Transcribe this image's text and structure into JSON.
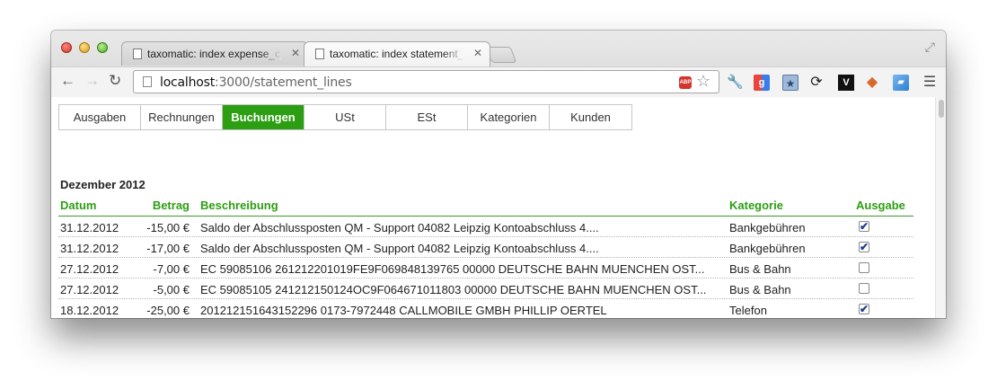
{
  "browser": {
    "tabs": [
      {
        "label": "taxomatic: index expense_ca"
      },
      {
        "label": "taxomatic: index statement_"
      }
    ],
    "url_host": "localhost",
    "url_rest": ":3000/statement_lines",
    "abp_text": "ABP",
    "extension_icons": [
      "wrench-icon",
      "google-icon",
      "bookmark-icon",
      "sync-icon",
      "vim-icon",
      "fox-icon",
      "note-icon",
      "menu-icon"
    ]
  },
  "nav": {
    "items": [
      {
        "label": "Ausgaben"
      },
      {
        "label": "Rechnungen"
      },
      {
        "label": "Buchungen"
      },
      {
        "label": "USt"
      },
      {
        "label": "ESt"
      },
      {
        "label": "Kategorien"
      },
      {
        "label": "Kunden"
      }
    ],
    "active_color": "#2c9e12"
  },
  "statements": {
    "month": "Dezember 2012",
    "headers": {
      "date": "Datum",
      "amount": "Betrag",
      "description": "Beschreibung",
      "category": "Kategorie",
      "expense": "Ausgabe"
    },
    "rows": [
      {
        "date": "31.12.2012",
        "amount": "-15,00 €",
        "description": "Saldo der Abschlussposten QM - Support 04082 Leipzig Kontoabschluss 4....",
        "category": "Bankgebühren",
        "expense": true
      },
      {
        "date": "31.12.2012",
        "amount": "-17,00 €",
        "description": "Saldo der Abschlussposten QM - Support 04082 Leipzig Kontoabschluss 4....",
        "category": "Bankgebühren",
        "expense": true
      },
      {
        "date": "27.12.2012",
        "amount": "-7,00 €",
        "description": "EC 59085106 261212201019FE9F069848139765 00000 DEUTSCHE BAHN MUENCHEN OST...",
        "category": "Bus & Bahn",
        "expense": false
      },
      {
        "date": "27.12.2012",
        "amount": "-5,00 €",
        "description": "EC 59085105 241212150124OC9F064671011803 00000 DEUTSCHE BAHN MUENCHEN OST...",
        "category": "Bus & Bahn",
        "expense": false
      },
      {
        "date": "18.12.2012",
        "amount": "-25,00 €",
        "description": "201212151643152296 0173-7972448 CALLMOBILE GMBH PHILLIP OERTEL",
        "category": "Telefon",
        "expense": true
      }
    ]
  }
}
